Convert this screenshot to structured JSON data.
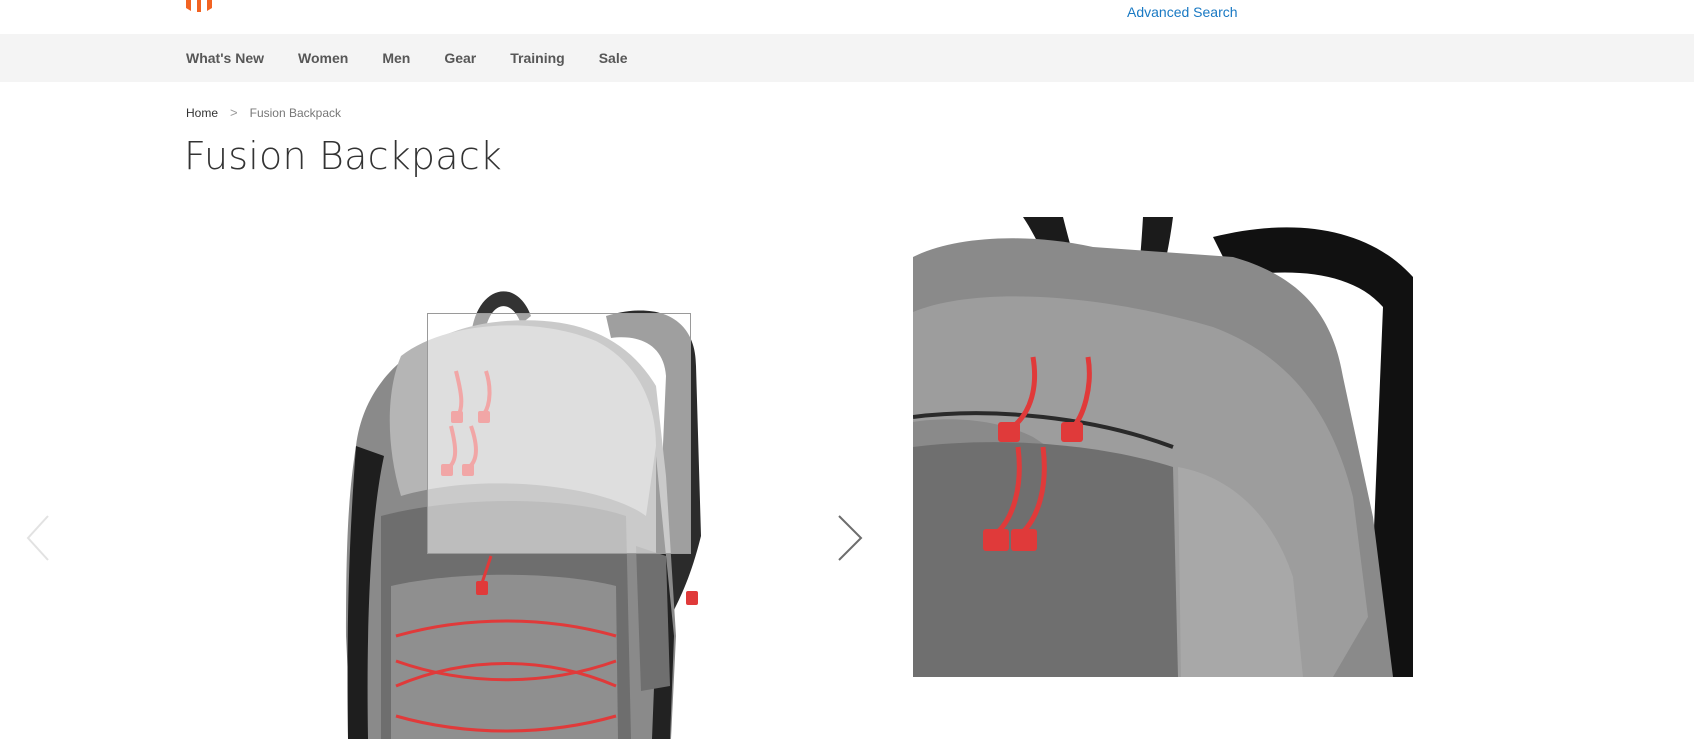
{
  "header": {
    "advanced_search_label": "Advanced Search",
    "logo_icon": "magento-logo-icon"
  },
  "nav": {
    "items": [
      "What's New",
      "Women",
      "Men",
      "Gear",
      "Training",
      "Sale"
    ]
  },
  "breadcrumb": {
    "home": "Home",
    "separator": ">",
    "current": "Fusion Backpack"
  },
  "product": {
    "title": "Fusion Backpack"
  },
  "gallery": {
    "prev_icon": "chevron-left-icon",
    "next_icon": "chevron-right-icon",
    "image_subject": "gray backpack with red zipper pulls"
  },
  "colors": {
    "brand_orange": "#f26322",
    "link_blue": "#1979c3",
    "nav_bg": "#f4f4f4",
    "accent_red": "#e03a3a"
  }
}
